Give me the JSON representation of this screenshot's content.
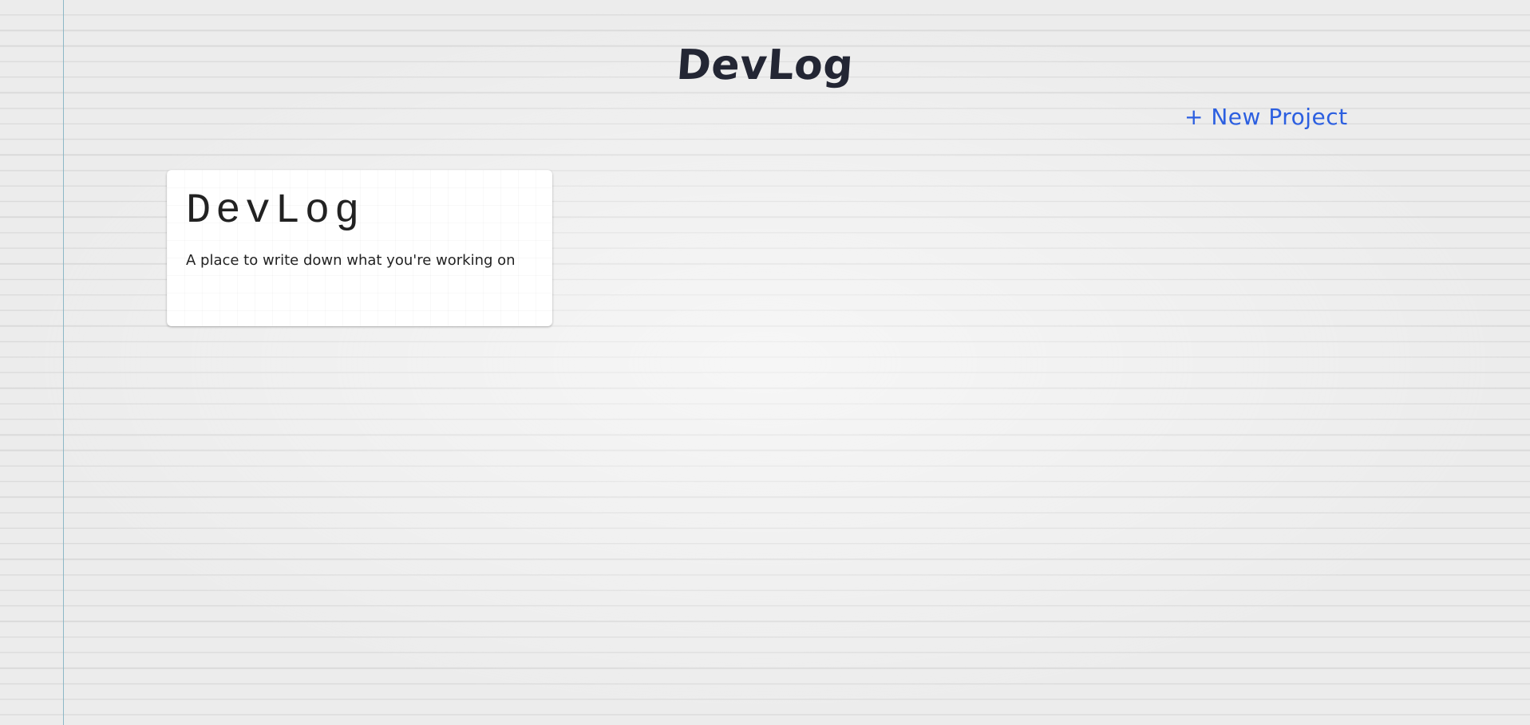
{
  "header": {
    "title": "DevLog"
  },
  "actions": {
    "new_project_label": "+ New Project"
  },
  "projects": [
    {
      "title": "DevLog",
      "description": "A place to write down what you're working on"
    }
  ],
  "colors": {
    "background": "#ececec",
    "rule_line": "#dadada",
    "margin_line": "#8db7c6",
    "title_text": "#232634",
    "link_accent": "#2c5fe0",
    "card_background": "#ffffff"
  }
}
